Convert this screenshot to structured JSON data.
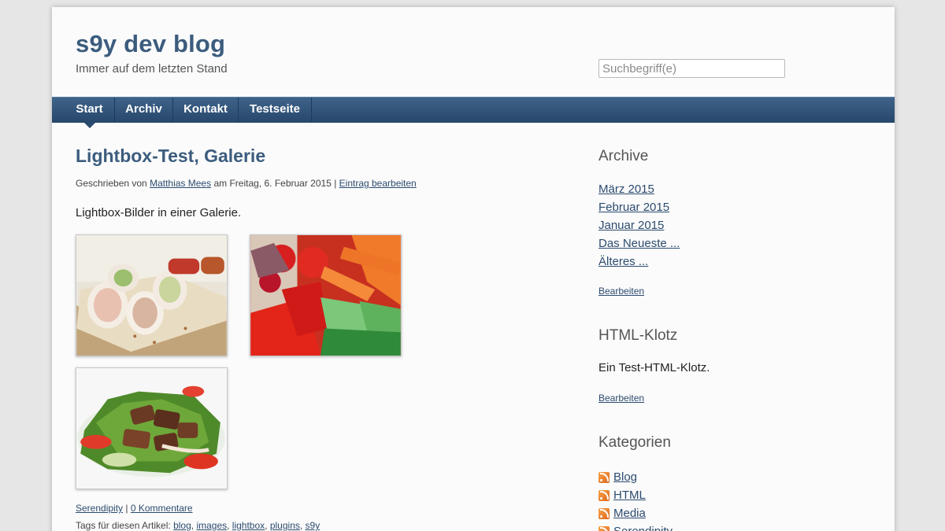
{
  "header": {
    "site_title": "s9y dev blog",
    "tagline": "Immer auf dem letzten Stand",
    "search_placeholder": "Suchbegriff(e)"
  },
  "nav": {
    "items": [
      {
        "label": "Start",
        "active": true
      },
      {
        "label": "Archiv",
        "active": false
      },
      {
        "label": "Kontakt",
        "active": false
      },
      {
        "label": "Testseite",
        "active": false
      }
    ]
  },
  "post": {
    "title": "Lightbox-Test, Galerie",
    "meta_prefix": "Geschrieben von",
    "author": "Matthias Mees",
    "meta_date": "am Freitag, 6. Februar 2015 |",
    "edit_link": "Eintrag bearbeiten",
    "body": "Lightbox-Bilder in einer Galerie.",
    "images": [
      "spring-rolls-image",
      "vegetables-image",
      "beef-salad-image"
    ],
    "category": "Serendipity",
    "comments": "0 Kommentare",
    "tags_label": "Tags für diesen Artikel:",
    "tags": [
      "blog",
      "images",
      "lightbox",
      "plugins",
      "s9y"
    ]
  },
  "sidebar": {
    "archive": {
      "title": "Archive",
      "items": [
        "März 2015",
        "Februar 2015",
        "Januar 2015",
        "Das Neueste ...",
        "Älteres ..."
      ],
      "edit": "Bearbeiten"
    },
    "html_block": {
      "title": "HTML-Klotz",
      "text": "Ein Test-HTML-Klotz.",
      "edit": "Bearbeiten"
    },
    "categories": {
      "title": "Kategorien",
      "items": [
        "Blog",
        "HTML",
        "Media",
        "Serendipity"
      ]
    }
  },
  "colors": {
    "accent": "#3c5c7e",
    "nav_bg": "#2f5074",
    "link": "#2c4b6f",
    "rss": "#e87722"
  }
}
